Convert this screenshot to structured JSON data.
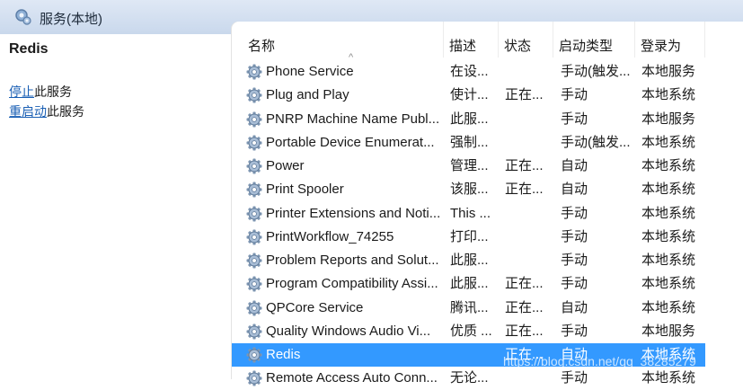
{
  "window": {
    "title": "服务(本地)",
    "icon": "services-icon"
  },
  "left_pane": {
    "service_name": "Redis",
    "actions": [
      {
        "link": "停止",
        "suffix": "此服务"
      },
      {
        "link": "重启动",
        "suffix": "此服务"
      }
    ]
  },
  "list": {
    "headers": {
      "name": "名称",
      "description": "描述",
      "status": "状态",
      "startup": "启动类型",
      "logon": "登录为"
    },
    "sort_indicator": "^",
    "rows": [
      {
        "name": "Phone Service",
        "description": "在设...",
        "status": "",
        "startup": "手动(触发...",
        "logon": "本地服务"
      },
      {
        "name": "Plug and Play",
        "description": "使计...",
        "status": "正在...",
        "startup": "手动",
        "logon": "本地系统"
      },
      {
        "name": "PNRP Machine Name Publ...",
        "description": "此服...",
        "status": "",
        "startup": "手动",
        "logon": "本地服务"
      },
      {
        "name": "Portable Device Enumerat...",
        "description": "强制...",
        "status": "",
        "startup": "手动(触发...",
        "logon": "本地系统"
      },
      {
        "name": "Power",
        "description": "管理...",
        "status": "正在...",
        "startup": "自动",
        "logon": "本地系统"
      },
      {
        "name": "Print Spooler",
        "description": "该服...",
        "status": "正在...",
        "startup": "自动",
        "logon": "本地系统"
      },
      {
        "name": "Printer Extensions and Noti...",
        "description": "This ...",
        "status": "",
        "startup": "手动",
        "logon": "本地系统"
      },
      {
        "name": "PrintWorkflow_74255",
        "description": "打印...",
        "status": "",
        "startup": "手动",
        "logon": "本地系统"
      },
      {
        "name": "Problem Reports and Solut...",
        "description": "此服...",
        "status": "",
        "startup": "手动",
        "logon": "本地系统"
      },
      {
        "name": "Program Compatibility Assi...",
        "description": "此服...",
        "status": "正在...",
        "startup": "手动",
        "logon": "本地系统"
      },
      {
        "name": "QPCore Service",
        "description": "腾讯...",
        "status": "正在...",
        "startup": "自动",
        "logon": "本地系统"
      },
      {
        "name": "Quality Windows Audio Vi...",
        "description": "优质 ...",
        "status": "正在...",
        "startup": "手动",
        "logon": "本地服务"
      },
      {
        "name": "Redis",
        "description": "",
        "status": "正在...",
        "startup": "自动",
        "logon": "本地系统",
        "selected": true
      },
      {
        "name": "Remote Access Auto Conn...",
        "description": "无论...",
        "status": "",
        "startup": "手动",
        "logon": "本地系统"
      }
    ],
    "row_icon": "gear-icon",
    "selection_color": "#3399ff"
  },
  "watermark": "https://blog.csdn.net/qq_38285279"
}
